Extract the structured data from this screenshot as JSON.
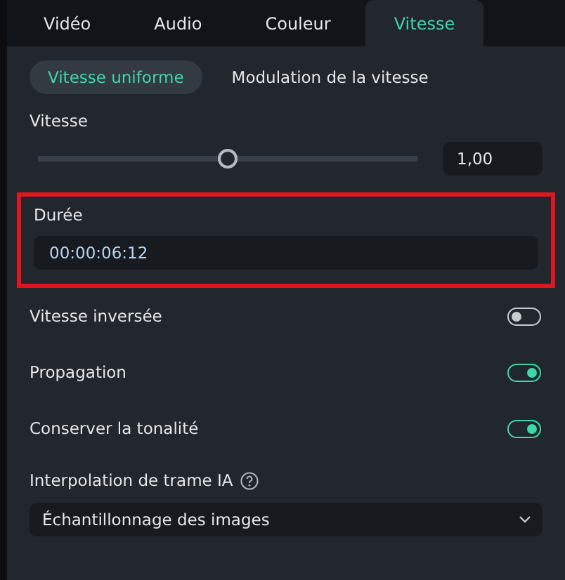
{
  "tabs": [
    {
      "label": "Vidéo",
      "selected": false
    },
    {
      "label": "Audio",
      "selected": false
    },
    {
      "label": "Couleur",
      "selected": false
    },
    {
      "label": "Vitesse",
      "selected": true
    }
  ],
  "modes": [
    {
      "label": "Vitesse uniforme",
      "selected": true
    },
    {
      "label": "Modulation de la vitesse",
      "selected": false
    }
  ],
  "speed": {
    "label": "Vitesse",
    "level": 0.5,
    "value": "1,00"
  },
  "duration": {
    "label": "Durée",
    "value": "00:00:06:12",
    "highlighted": true
  },
  "toggles": [
    {
      "label": "Vitesse inversée",
      "on": false
    },
    {
      "label": "Propagation",
      "on": true
    },
    {
      "label": "Conserver la tonalité",
      "on": true
    }
  ],
  "interpolation": {
    "label": "Interpolation de trame IA",
    "value": "Échantillonnage des images"
  }
}
